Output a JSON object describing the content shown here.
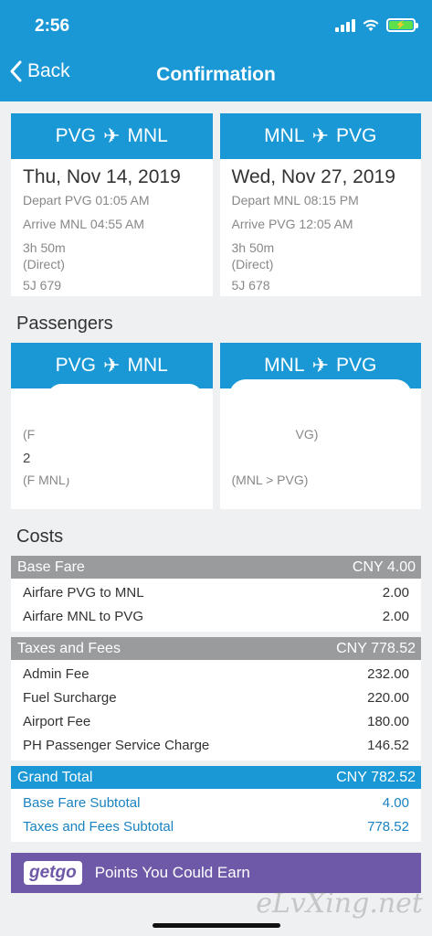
{
  "status": {
    "time": "2:56",
    "battery_icon": "battery-charging-icon"
  },
  "nav": {
    "back_label": "Back",
    "title": "Confirmation"
  },
  "flights": [
    {
      "route_from": "PVG",
      "route_to": "MNL",
      "date": "Thu, Nov 14, 2019",
      "depart_label": "Depart",
      "depart_airport": "PVG",
      "depart_time": "01:05 AM",
      "arrive_label": "Arrive",
      "arrive_airport": "MNL",
      "arrive_time": "04:55 AM",
      "duration": "3h 50m",
      "stops": "(Direct)",
      "flight_no": "5J 679"
    },
    {
      "route_from": "MNL",
      "route_to": "PVG",
      "date": "Wed, Nov 27, 2019",
      "depart_label": "Depart",
      "depart_airport": "MNL",
      "depart_time": "08:15 PM",
      "arrive_label": "Arrive",
      "arrive_airport": "PVG",
      "arrive_time": "12:05 AM",
      "duration": "3h 50m",
      "stops": "(Direct)",
      "flight_no": "5J 678"
    }
  ],
  "passengers": {
    "title": "Passengers",
    "cards": [
      {
        "route_from": "PVG",
        "route_to": "MNL",
        "rows": [
          {
            "name": "",
            "route": "(F"
          },
          {
            "name": "2",
            "route": "(F      MNL)"
          }
        ]
      },
      {
        "route_from": "MNL",
        "route_to": "PVG",
        "rows": [
          {
            "name": "",
            "route": "VG)"
          },
          {
            "name": "",
            "route": "(MNL > PVG)"
          }
        ]
      }
    ]
  },
  "costs": {
    "title": "Costs",
    "base": {
      "label": "Base Fare",
      "amount": "CNY 4.00",
      "items": [
        {
          "label": "Airfare PVG to MNL",
          "value": "2.00"
        },
        {
          "label": "Airfare MNL to PVG",
          "value": "2.00"
        }
      ]
    },
    "taxes": {
      "label": "Taxes and Fees",
      "amount": "CNY 778.52",
      "items": [
        {
          "label": "Admin Fee",
          "value": "232.00"
        },
        {
          "label": "Fuel Surcharge",
          "value": "220.00"
        },
        {
          "label": "Airport Fee",
          "value": "180.00"
        },
        {
          "label": "PH Passenger Service Charge",
          "value": "146.52"
        }
      ]
    },
    "total": {
      "label": "Grand Total",
      "amount": "CNY 782.52",
      "items": [
        {
          "label": "Base Fare Subtotal",
          "value": "4.00"
        },
        {
          "label": "Taxes and Fees Subtotal",
          "value": "778.52"
        }
      ]
    }
  },
  "promo": {
    "logo": "getgo",
    "text": "Points You Could Earn"
  },
  "watermark": "eLvXing.net",
  "colors": {
    "primary": "#1a98d5",
    "gray_bar": "#9a9b9d",
    "promo": "#6e59a8"
  }
}
